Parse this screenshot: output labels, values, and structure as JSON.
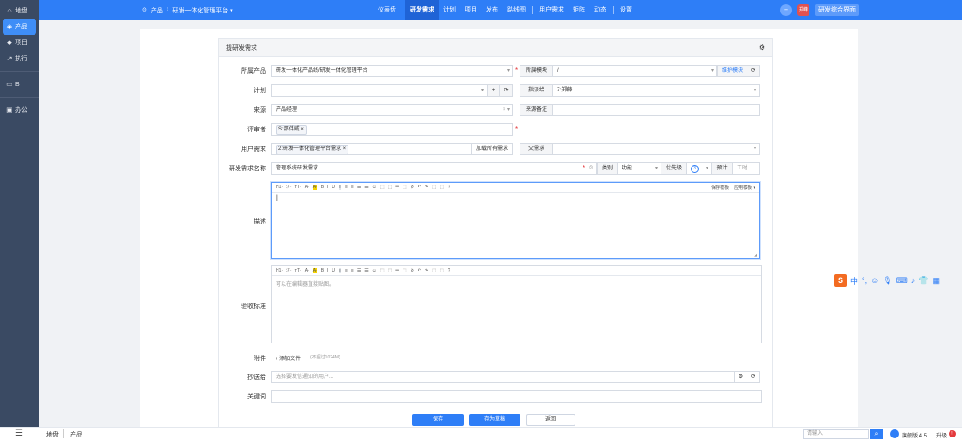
{
  "sidebar": {
    "items": [
      {
        "icon": "⌂",
        "label": "地盘"
      },
      {
        "icon": "◈",
        "label": "产品",
        "active": true
      },
      {
        "icon": "◆",
        "label": "项目"
      },
      {
        "icon": "↗",
        "label": "执行"
      },
      {
        "icon": "▭",
        "label": "BI"
      },
      {
        "icon": "▣",
        "label": "办公"
      }
    ],
    "menu_icon": "☰"
  },
  "topbar": {
    "breadcrumb": [
      "产品",
      "›",
      "研发一体化管理平台 ▾"
    ],
    "tabs": [
      "仪表盘",
      "研发需求",
      "计划",
      "项目",
      "发布",
      "路线图",
      "用户需求",
      "矩阵",
      "动态",
      "设置"
    ],
    "active_tab": "研发需求",
    "plus": "+",
    "avatar": "郑峰",
    "toggle": "研发综合界面"
  },
  "panel": {
    "title": "提研发需求",
    "gear": "⚙"
  },
  "form": {
    "product_label": "所属产品",
    "product_value": "研发一体化产品线/研发一体化管理平台",
    "module_label": "所属模块",
    "module_value": "/",
    "module_link": "维护模块",
    "plan_label": "计划",
    "plan_plus": "+",
    "plan_refresh": "⟳",
    "assigned_label": "指派给",
    "assigned_value": "Z:郑薛",
    "source_label": "来源",
    "source_value": "产品经理",
    "source_note_label": "来源备注",
    "reviewer_label": "评审者",
    "reviewer_value": "S:邵伟威",
    "ur_label": "用户需求",
    "ur_value": "2:研发一体化管理平台需求",
    "ur_btn": "加载所有需求",
    "parent_label": "父需求",
    "name_label": "研发需求名称",
    "name_value": "管理系统研发需求",
    "category_label": "类别",
    "category_value": "功能",
    "priority_label": "优先级",
    "priority_value": "3",
    "estimate_label": "预计",
    "estimate_unit": "工时",
    "desc_label": "描述",
    "save_template": "保存模板",
    "apply_template": "应用模板",
    "toolbar": [
      "H1·",
      "ℱ·",
      "ᴛT·",
      "A·",
      "A·",
      "B",
      "I",
      "U",
      "≡",
      "≡",
      "≡",
      "☰",
      "☰",
      "☺",
      "⬚",
      "⬚",
      "═",
      "⬚",
      "⊘",
      "↶",
      "↷",
      "⬚",
      "⬚",
      "?"
    ],
    "verify_label": "验收标准",
    "verify_placeholder": "可以在编辑器直接贴图。",
    "attach_label": "附件",
    "attach_btn": "+ 添加文件",
    "attach_hint": "(不超过1024M)",
    "mailto_label": "抄送给",
    "mailto_placeholder": "选择要发信通知的用户...",
    "keywords_label": "关键词",
    "save": "保存",
    "save_draft": "存为草稿",
    "back": "返回"
  },
  "footer": {
    "crumb1": "地盘",
    "crumb2": "产品",
    "search_placeholder": "请输入",
    "version": "旗舰版 4.5",
    "upgrade": "升级"
  },
  "ime": {
    "logo": "S",
    "mode": "中",
    "punct": "°,"
  }
}
